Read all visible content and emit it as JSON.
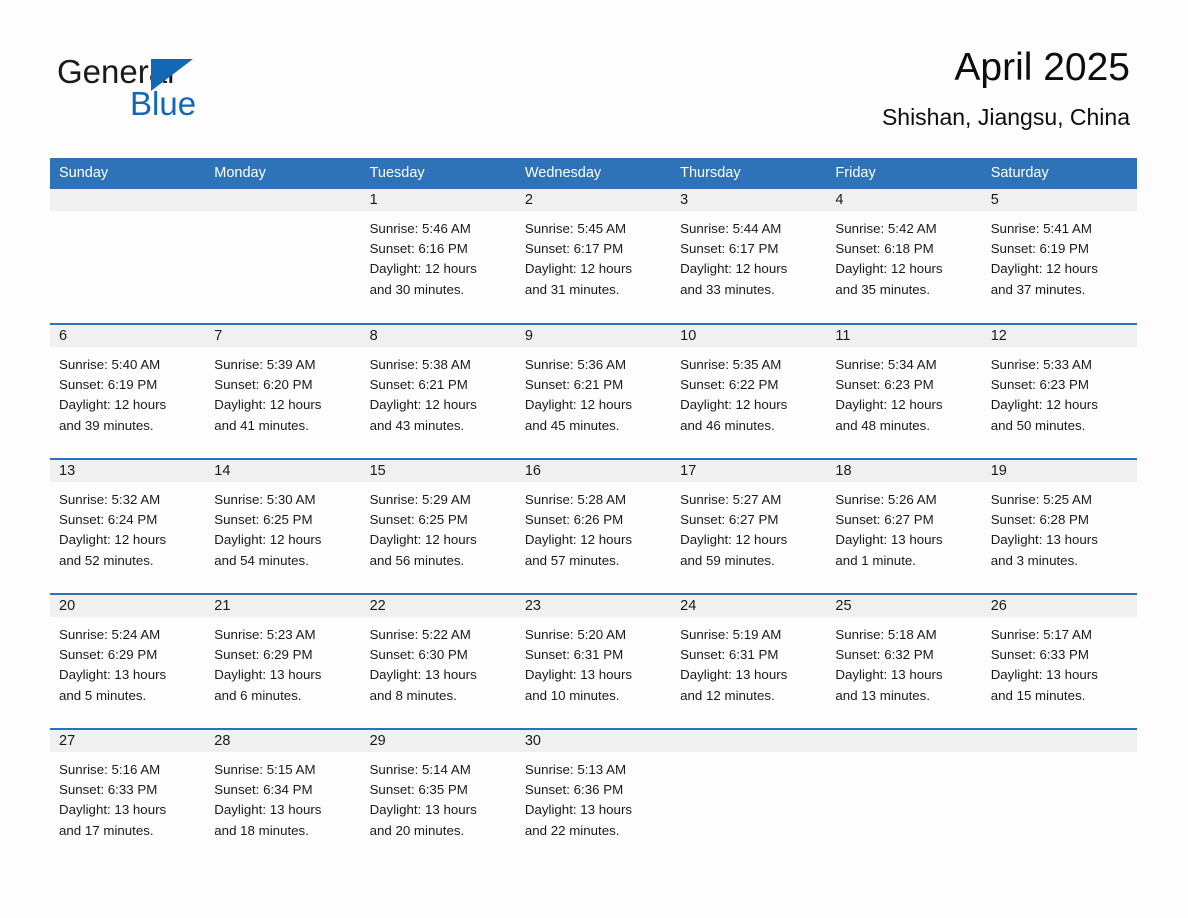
{
  "brand": {
    "name_part1": "General",
    "name_part2": "Blue",
    "triangle_icon": "triangle-icon",
    "accent_color": "#1268b3"
  },
  "header": {
    "month_title": "April 2025",
    "location": "Shishan, Jiangsu, China"
  },
  "calendar": {
    "header_bg": "#2e72b8",
    "daynum_band_bg": "#f0f0f0",
    "weekday_headers": [
      "Sunday",
      "Monday",
      "Tuesday",
      "Wednesday",
      "Thursday",
      "Friday",
      "Saturday"
    ],
    "weeks": [
      [
        {
          "day": "",
          "sunrise": "",
          "sunset": "",
          "daylight_line1": "",
          "daylight_line2": ""
        },
        {
          "day": "",
          "sunrise": "",
          "sunset": "",
          "daylight_line1": "",
          "daylight_line2": ""
        },
        {
          "day": "1",
          "sunrise": "Sunrise: 5:46 AM",
          "sunset": "Sunset: 6:16 PM",
          "daylight_line1": "Daylight: 12 hours",
          "daylight_line2": "and 30 minutes."
        },
        {
          "day": "2",
          "sunrise": "Sunrise: 5:45 AM",
          "sunset": "Sunset: 6:17 PM",
          "daylight_line1": "Daylight: 12 hours",
          "daylight_line2": "and 31 minutes."
        },
        {
          "day": "3",
          "sunrise": "Sunrise: 5:44 AM",
          "sunset": "Sunset: 6:17 PM",
          "daylight_line1": "Daylight: 12 hours",
          "daylight_line2": "and 33 minutes."
        },
        {
          "day": "4",
          "sunrise": "Sunrise: 5:42 AM",
          "sunset": "Sunset: 6:18 PM",
          "daylight_line1": "Daylight: 12 hours",
          "daylight_line2": "and 35 minutes."
        },
        {
          "day": "5",
          "sunrise": "Sunrise: 5:41 AM",
          "sunset": "Sunset: 6:19 PM",
          "daylight_line1": "Daylight: 12 hours",
          "daylight_line2": "and 37 minutes."
        }
      ],
      [
        {
          "day": "6",
          "sunrise": "Sunrise: 5:40 AM",
          "sunset": "Sunset: 6:19 PM",
          "daylight_line1": "Daylight: 12 hours",
          "daylight_line2": "and 39 minutes."
        },
        {
          "day": "7",
          "sunrise": "Sunrise: 5:39 AM",
          "sunset": "Sunset: 6:20 PM",
          "daylight_line1": "Daylight: 12 hours",
          "daylight_line2": "and 41 minutes."
        },
        {
          "day": "8",
          "sunrise": "Sunrise: 5:38 AM",
          "sunset": "Sunset: 6:21 PM",
          "daylight_line1": "Daylight: 12 hours",
          "daylight_line2": "and 43 minutes."
        },
        {
          "day": "9",
          "sunrise": "Sunrise: 5:36 AM",
          "sunset": "Sunset: 6:21 PM",
          "daylight_line1": "Daylight: 12 hours",
          "daylight_line2": "and 45 minutes."
        },
        {
          "day": "10",
          "sunrise": "Sunrise: 5:35 AM",
          "sunset": "Sunset: 6:22 PM",
          "daylight_line1": "Daylight: 12 hours",
          "daylight_line2": "and 46 minutes."
        },
        {
          "day": "11",
          "sunrise": "Sunrise: 5:34 AM",
          "sunset": "Sunset: 6:23 PM",
          "daylight_line1": "Daylight: 12 hours",
          "daylight_line2": "and 48 minutes."
        },
        {
          "day": "12",
          "sunrise": "Sunrise: 5:33 AM",
          "sunset": "Sunset: 6:23 PM",
          "daylight_line1": "Daylight: 12 hours",
          "daylight_line2": "and 50 minutes."
        }
      ],
      [
        {
          "day": "13",
          "sunrise": "Sunrise: 5:32 AM",
          "sunset": "Sunset: 6:24 PM",
          "daylight_line1": "Daylight: 12 hours",
          "daylight_line2": "and 52 minutes."
        },
        {
          "day": "14",
          "sunrise": "Sunrise: 5:30 AM",
          "sunset": "Sunset: 6:25 PM",
          "daylight_line1": "Daylight: 12 hours",
          "daylight_line2": "and 54 minutes."
        },
        {
          "day": "15",
          "sunrise": "Sunrise: 5:29 AM",
          "sunset": "Sunset: 6:25 PM",
          "daylight_line1": "Daylight: 12 hours",
          "daylight_line2": "and 56 minutes."
        },
        {
          "day": "16",
          "sunrise": "Sunrise: 5:28 AM",
          "sunset": "Sunset: 6:26 PM",
          "daylight_line1": "Daylight: 12 hours",
          "daylight_line2": "and 57 minutes."
        },
        {
          "day": "17",
          "sunrise": "Sunrise: 5:27 AM",
          "sunset": "Sunset: 6:27 PM",
          "daylight_line1": "Daylight: 12 hours",
          "daylight_line2": "and 59 minutes."
        },
        {
          "day": "18",
          "sunrise": "Sunrise: 5:26 AM",
          "sunset": "Sunset: 6:27 PM",
          "daylight_line1": "Daylight: 13 hours",
          "daylight_line2": "and 1 minute."
        },
        {
          "day": "19",
          "sunrise": "Sunrise: 5:25 AM",
          "sunset": "Sunset: 6:28 PM",
          "daylight_line1": "Daylight: 13 hours",
          "daylight_line2": "and 3 minutes."
        }
      ],
      [
        {
          "day": "20",
          "sunrise": "Sunrise: 5:24 AM",
          "sunset": "Sunset: 6:29 PM",
          "daylight_line1": "Daylight: 13 hours",
          "daylight_line2": "and 5 minutes."
        },
        {
          "day": "21",
          "sunrise": "Sunrise: 5:23 AM",
          "sunset": "Sunset: 6:29 PM",
          "daylight_line1": "Daylight: 13 hours",
          "daylight_line2": "and 6 minutes."
        },
        {
          "day": "22",
          "sunrise": "Sunrise: 5:22 AM",
          "sunset": "Sunset: 6:30 PM",
          "daylight_line1": "Daylight: 13 hours",
          "daylight_line2": "and 8 minutes."
        },
        {
          "day": "23",
          "sunrise": "Sunrise: 5:20 AM",
          "sunset": "Sunset: 6:31 PM",
          "daylight_line1": "Daylight: 13 hours",
          "daylight_line2": "and 10 minutes."
        },
        {
          "day": "24",
          "sunrise": "Sunrise: 5:19 AM",
          "sunset": "Sunset: 6:31 PM",
          "daylight_line1": "Daylight: 13 hours",
          "daylight_line2": "and 12 minutes."
        },
        {
          "day": "25",
          "sunrise": "Sunrise: 5:18 AM",
          "sunset": "Sunset: 6:32 PM",
          "daylight_line1": "Daylight: 13 hours",
          "daylight_line2": "and 13 minutes."
        },
        {
          "day": "26",
          "sunrise": "Sunrise: 5:17 AM",
          "sunset": "Sunset: 6:33 PM",
          "daylight_line1": "Daylight: 13 hours",
          "daylight_line2": "and 15 minutes."
        }
      ],
      [
        {
          "day": "27",
          "sunrise": "Sunrise: 5:16 AM",
          "sunset": "Sunset: 6:33 PM",
          "daylight_line1": "Daylight: 13 hours",
          "daylight_line2": "and 17 minutes."
        },
        {
          "day": "28",
          "sunrise": "Sunrise: 5:15 AM",
          "sunset": "Sunset: 6:34 PM",
          "daylight_line1": "Daylight: 13 hours",
          "daylight_line2": "and 18 minutes."
        },
        {
          "day": "29",
          "sunrise": "Sunrise: 5:14 AM",
          "sunset": "Sunset: 6:35 PM",
          "daylight_line1": "Daylight: 13 hours",
          "daylight_line2": "and 20 minutes."
        },
        {
          "day": "30",
          "sunrise": "Sunrise: 5:13 AM",
          "sunset": "Sunset: 6:36 PM",
          "daylight_line1": "Daylight: 13 hours",
          "daylight_line2": "and 22 minutes."
        },
        {
          "day": "",
          "sunrise": "",
          "sunset": "",
          "daylight_line1": "",
          "daylight_line2": ""
        },
        {
          "day": "",
          "sunrise": "",
          "sunset": "",
          "daylight_line1": "",
          "daylight_line2": ""
        },
        {
          "day": "",
          "sunrise": "",
          "sunset": "",
          "daylight_line1": "",
          "daylight_line2": ""
        }
      ]
    ]
  }
}
